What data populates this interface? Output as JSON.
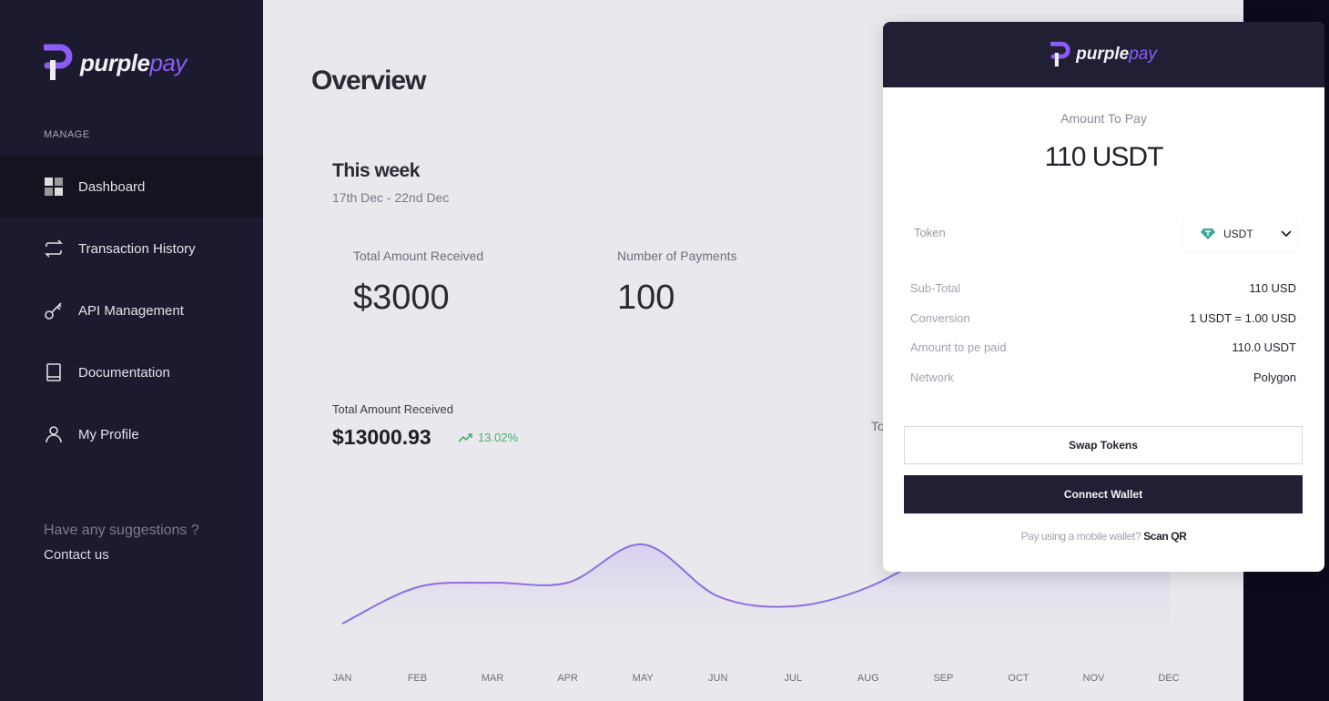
{
  "sidebar": {
    "brand": {
      "name_a": "purple",
      "name_b": "pay"
    },
    "section": "MANAGE",
    "items": [
      {
        "label": "Dashboard",
        "icon": "grid-icon",
        "active": true
      },
      {
        "label": "Transaction History",
        "icon": "repeat-icon"
      },
      {
        "label": "API Management",
        "icon": "key-icon"
      },
      {
        "label": "Documentation",
        "icon": "book-icon"
      },
      {
        "label": "My Profile",
        "icon": "user-icon"
      }
    ],
    "suggestion": "Have any suggestions ?",
    "contact": "Contact us"
  },
  "main": {
    "title": "Overview",
    "week": {
      "title": "This week",
      "range": "17th Dec - 22nd Dec",
      "stats": [
        {
          "label": "Total Amount Received",
          "value": "$3000"
        },
        {
          "label": "Number of Payments",
          "value": "100"
        }
      ]
    },
    "total": {
      "label": "Total Amount Received",
      "value": "$13000.93",
      "change": "13.02%",
      "change_color": "#4caf70"
    },
    "partial_label": "To"
  },
  "chart_data": {
    "type": "area",
    "categories": [
      "JAN",
      "FEB",
      "MAR",
      "APR",
      "MAY",
      "JUN",
      "JUL",
      "AUG",
      "SEP",
      "OCT",
      "NOV",
      "DEC"
    ],
    "values": [
      10,
      50,
      55,
      55,
      97,
      40,
      29,
      50,
      95,
      null,
      null,
      null
    ],
    "color": "#8b6fe0",
    "grid": false
  },
  "modal": {
    "brand": {
      "name_a": "purple",
      "name_b": "pay"
    },
    "amount_label": "Amount To Pay",
    "amount": "110 USDT",
    "token_label": "Token",
    "token": "USDT",
    "rows": [
      {
        "k": "Sub-Total",
        "v": "110 USD"
      },
      {
        "k": "Conversion",
        "v": "1 USDT = 1.00 USD"
      },
      {
        "k": "Amount to pe paid",
        "v": "110.0 USDT"
      },
      {
        "k": "Network",
        "v": "Polygon"
      }
    ],
    "swap": "Swap Tokens",
    "connect": "Connect Wallet",
    "scan_prefix": "Pay using a mobile wallet?",
    "scan_link": "Scan QR"
  }
}
